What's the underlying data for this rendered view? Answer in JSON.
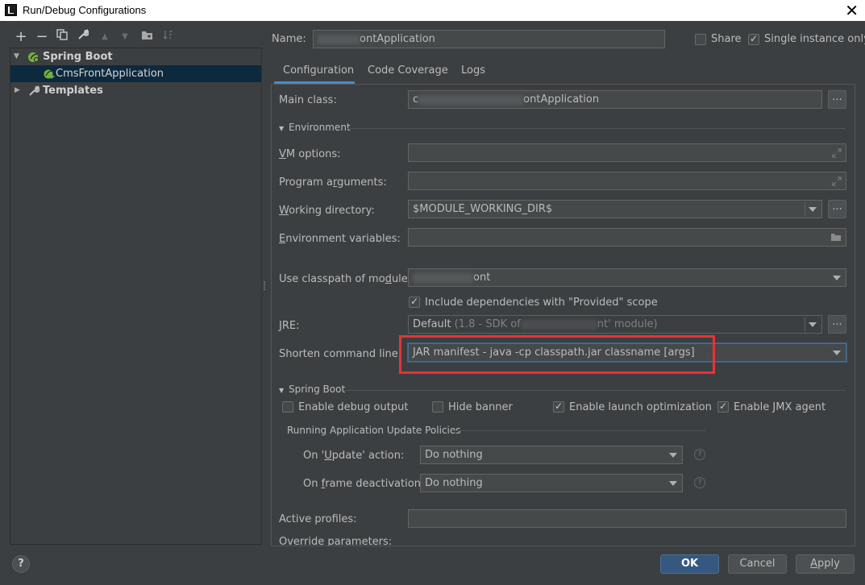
{
  "window": {
    "title": "Run/Debug Configurations",
    "close_glyph": "✕"
  },
  "left_toolbar": {
    "add": "+",
    "remove": "−",
    "copy": "copy-icon",
    "edit": "wrench-icon",
    "move_up": "▲",
    "move_down": "▼",
    "folder": "folder-icon",
    "sort": "sort-icon"
  },
  "tree": {
    "spring_boot": "Spring Boot",
    "app": "CmsFrontApplication",
    "templates": "Templates"
  },
  "header": {
    "name_label": "Name:",
    "name_value": "ontApplication",
    "share_label": "Share",
    "share_checked": false,
    "single_label": "Single instance only",
    "single_checked": true
  },
  "tabs": [
    "Configuration",
    "Code Coverage",
    "Logs"
  ],
  "config": {
    "main_class_label": "Main class:",
    "main_class_value_prefix": "c",
    "main_class_value": "ontApplication",
    "environment_section": "Environment",
    "vm_options_label": "VM options:",
    "program_args_label": "Program arguments:",
    "working_dir_label": "Working directory:",
    "working_dir_value": "$MODULE_WORKING_DIR$",
    "env_vars_label": "Environment variables:",
    "classpath_label": "Use classpath of module:",
    "classpath_value": "ont",
    "include_deps_label": "Include dependencies with \"Provided\" scope",
    "include_deps_checked": true,
    "jre_label": "JRE:",
    "jre_value_main": "Default",
    "jre_value_detail_a": "(1.8 - SDK of",
    "jre_value_detail_b": "nt' module)",
    "shorten_label": "Shorten command line:",
    "shorten_value": "JAR manifest - java -cp classpath.jar classname [args]",
    "spring_boot_section": "Spring Boot",
    "enable_debug": "Enable debug output",
    "enable_debug_checked": false,
    "hide_banner": "Hide banner",
    "hide_banner_checked": false,
    "launch_opt": "Enable launch optimization",
    "launch_opt_checked": true,
    "jmx_agent": "Enable JMX agent",
    "jmx_checked": true,
    "update_policies_label": "Running Application Update Policies",
    "on_update_label": "On 'Update' action:",
    "on_update_value": "Do nothing",
    "on_frame_label": "On frame deactivation:",
    "on_frame_value": "Do nothing",
    "active_profiles_label": "Active profiles:",
    "override_params_label": "Override parameters:",
    "ellipsis": "..."
  },
  "footer": {
    "help": "?",
    "ok": "OK",
    "cancel": "Cancel",
    "apply": "Apply"
  },
  "colors": {
    "highlight_box": "#e8323a",
    "ok_button": "#365880",
    "selection": "#0d293e"
  }
}
